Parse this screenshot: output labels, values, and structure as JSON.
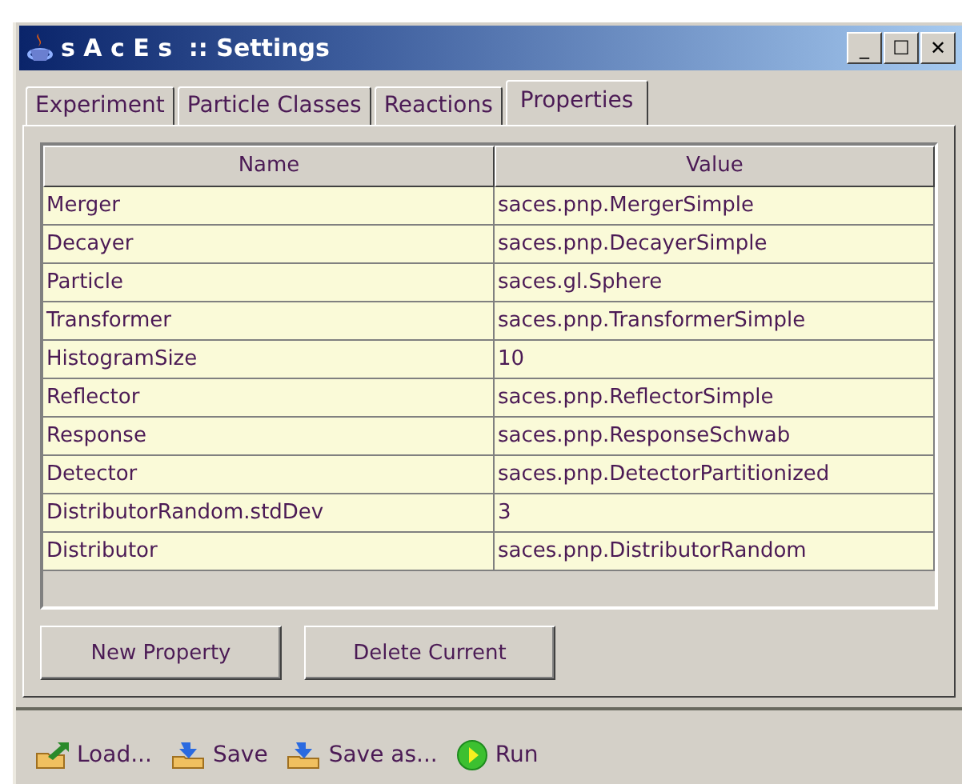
{
  "window": {
    "title": "s A c E s  :: Settings"
  },
  "window_buttons": [
    "_",
    "☐",
    "✕"
  ],
  "tabs": [
    {
      "label": "Experiment",
      "selected": false
    },
    {
      "label": "Particle Classes",
      "selected": false
    },
    {
      "label": "Reactions",
      "selected": false
    },
    {
      "label": "Properties",
      "selected": true
    }
  ],
  "table": {
    "columns": [
      "Name",
      "Value"
    ],
    "rows": [
      [
        "Merger",
        "saces.pnp.MergerSimple"
      ],
      [
        "Decayer",
        "saces.pnp.DecayerSimple"
      ],
      [
        "Particle",
        "saces.gl.Sphere"
      ],
      [
        "Transformer",
        "saces.pnp.TransformerSimple"
      ],
      [
        "HistogramSize",
        "10"
      ],
      [
        "Reflector",
        "saces.pnp.ReflectorSimple"
      ],
      [
        "Response",
        "saces.pnp.ResponseSchwab"
      ],
      [
        "Detector",
        "saces.pnp.DetectorPartitionized"
      ],
      [
        "DistributorRandom.stdDev",
        "3"
      ],
      [
        "Distributor",
        "saces.pnp.DistributorRandom"
      ]
    ]
  },
  "buttons": [
    "New Property",
    "Delete Current"
  ],
  "toolbar": [
    {
      "kind": "load",
      "label": "Load..."
    },
    {
      "kind": "save",
      "label": "Save"
    },
    {
      "kind": "saveas",
      "label": "Save as..."
    },
    {
      "kind": "run",
      "label": "Run"
    }
  ]
}
